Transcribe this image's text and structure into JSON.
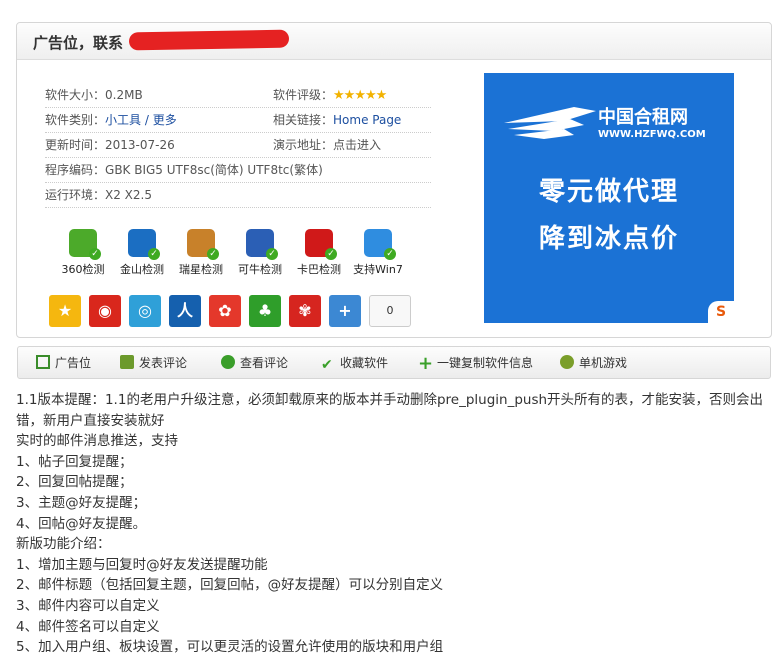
{
  "panel": {
    "title": "广告位，联系"
  },
  "info": {
    "size_label": "软件大小：",
    "size_value": "0.2MB",
    "rating_label": "软件评级：",
    "rating_stars": "★★★★★",
    "category_label": "软件类别：",
    "category_link1": "小工具",
    "category_sep": " / ",
    "category_link2": "更多",
    "related_label": "相关链接：",
    "related_value": "Home Page",
    "updated_label": "更新时间：",
    "updated_value": "2013-07-26",
    "demo_label": "演示地址：",
    "demo_value": "点击进入",
    "encoding_label": "程序编码：",
    "encoding_value": "GBK BIG5 UTF8sc(简体) UTF8tc(繁体)",
    "env_label": "运行环境：",
    "env_value": "X2 X2.5"
  },
  "scans": [
    {
      "label": "360检测",
      "icon": "shield-360-icon",
      "color": "#4caa2a"
    },
    {
      "label": "金山检测",
      "icon": "kingsoft-icon",
      "color": "#1b6ec2"
    },
    {
      "label": "瑞星检测",
      "icon": "rising-lion-icon",
      "color": "#c8812a"
    },
    {
      "label": "可牛检测",
      "icon": "keniu-shield-icon",
      "color": "#2b5fb5"
    },
    {
      "label": "卡巴检测",
      "icon": "kaspersky-icon",
      "color": "#d01919"
    },
    {
      "label": "支持Win7",
      "icon": "windows-icon",
      "color": "#2f8de0"
    }
  ],
  "shares": [
    {
      "name": "qzone-icon",
      "glyph": "★",
      "color": "#f5b70f"
    },
    {
      "name": "weibo-icon",
      "glyph": "◉",
      "color": "#d9271c"
    },
    {
      "name": "tencent-weibo-icon",
      "glyph": "◎",
      "color": "#2fa0d8"
    },
    {
      "name": "renren-icon",
      "glyph": "人",
      "color": "#1560ae"
    },
    {
      "name": "kaixin-icon",
      "glyph": "✿",
      "color": "#e4382b"
    },
    {
      "name": "clover-icon",
      "glyph": "♣",
      "color": "#2f9e2a"
    },
    {
      "name": "baidu-icon",
      "glyph": "✾",
      "color": "#d6251f"
    },
    {
      "name": "more-share-icon",
      "glyph": "+",
      "color": "#3c88d3"
    }
  ],
  "share_count": "0",
  "ad": {
    "brand": "中国合租网",
    "url": "WWW.HZFWQ.COM",
    "line1": "零元做代理",
    "line2": "降到冰点价",
    "corner": "S"
  },
  "toolbar": [
    {
      "label": "广告位",
      "icon": "download-icon",
      "color": "#3a8c2a"
    },
    {
      "label": "发表评论",
      "icon": "edit-icon",
      "color": "#6c9a2c"
    },
    {
      "label": "查看评论",
      "icon": "chat-bubble-icon",
      "color": "#3a9e2a"
    },
    {
      "label": "收藏软件",
      "icon": "checkmark-icon",
      "color": "#3aa02a"
    },
    {
      "label": "一键复制软件信息",
      "icon": "plus-icon",
      "color": "#3aa02a"
    },
    {
      "label": "单机游戏",
      "icon": "game-icon",
      "color": "#7a9e2a"
    }
  ],
  "description": [
    "1.1版本提醒：1.1的老用户升级注意，必须卸载原来的版本并手动删除pre_plugin_push开头所有的表，才能安装，否则会出错，新用户直接安装就好",
    "实时的邮件消息推送，支持",
    "1、帖子回复提醒；",
    "2、回复回帖提醒；",
    "3、主题@好友提醒；",
    "4、回帖@好友提醒。",
    "新版功能介绍：",
    "1、增加主题与回复时@好友发送提醒功能",
    "2、邮件标题（包括回复主题，回复回帖，@好友提醒）可以分别自定义",
    "3、邮件内容可以自定义",
    "4、邮件签名可以自定义",
    "5、加入用户组、板块设置，可以更灵活的设置允许使用的版块和用户组"
  ]
}
